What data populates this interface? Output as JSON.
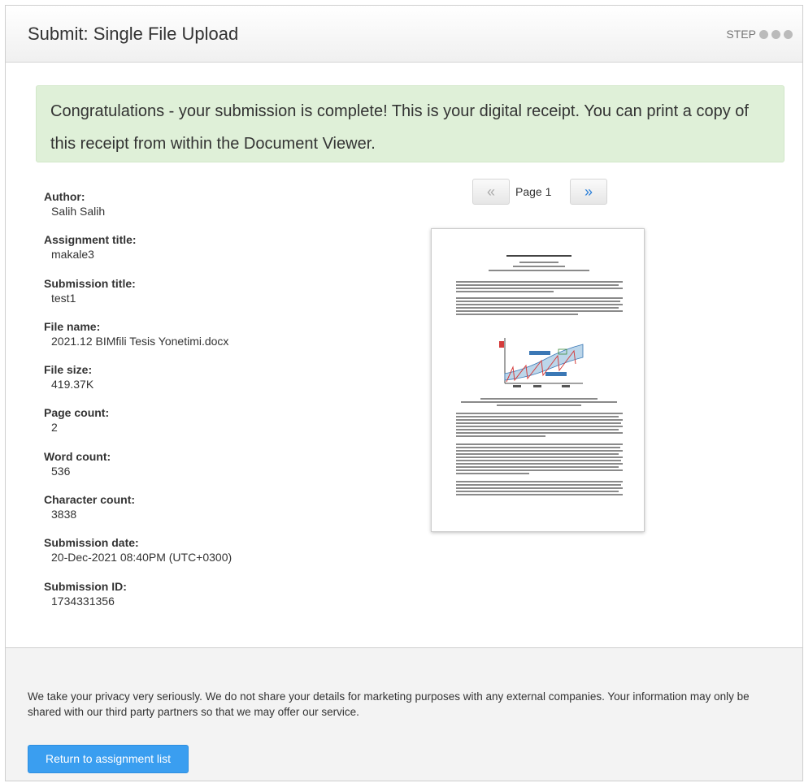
{
  "header": {
    "title": "Submit: Single File Upload",
    "step_label": "STEP"
  },
  "alert": {
    "message": "Congratulations - your submission is complete! This is your digital receipt. You can print a copy of this receipt from within the Document Viewer."
  },
  "receipt": [
    {
      "label": "Author:",
      "value": "Salih Salih"
    },
    {
      "label": "Assignment title:",
      "value": "makale3"
    },
    {
      "label": "Submission title:",
      "value": "test1"
    },
    {
      "label": "File name:",
      "value": "2021.12 BIMfili Tesis Yonetimi.docx"
    },
    {
      "label": "File size:",
      "value": "419.37K"
    },
    {
      "label": "Page count:",
      "value": "2"
    },
    {
      "label": "Word count:",
      "value": "536"
    },
    {
      "label": "Character count:",
      "value": "3838"
    },
    {
      "label": "Submission date:",
      "value": "20-Dec-2021 08:40PM (UTC+0300)"
    },
    {
      "label": "Submission ID:",
      "value": "1734331356"
    }
  ],
  "viewer": {
    "prev_label": "«",
    "page_label": "Page 1",
    "next_label": "»"
  },
  "footer": {
    "privacy_text": "We take your privacy very seriously. We do not share your details for marketing purposes with any external companies. Your information may only be shared with our third party partners so that we may offer our service.",
    "return_button_label": "Return to assignment list"
  },
  "colors": {
    "alert_bg": "#dff0d8",
    "primary_button": "#3a9ef0",
    "next_arrow": "#2b7fd8"
  }
}
